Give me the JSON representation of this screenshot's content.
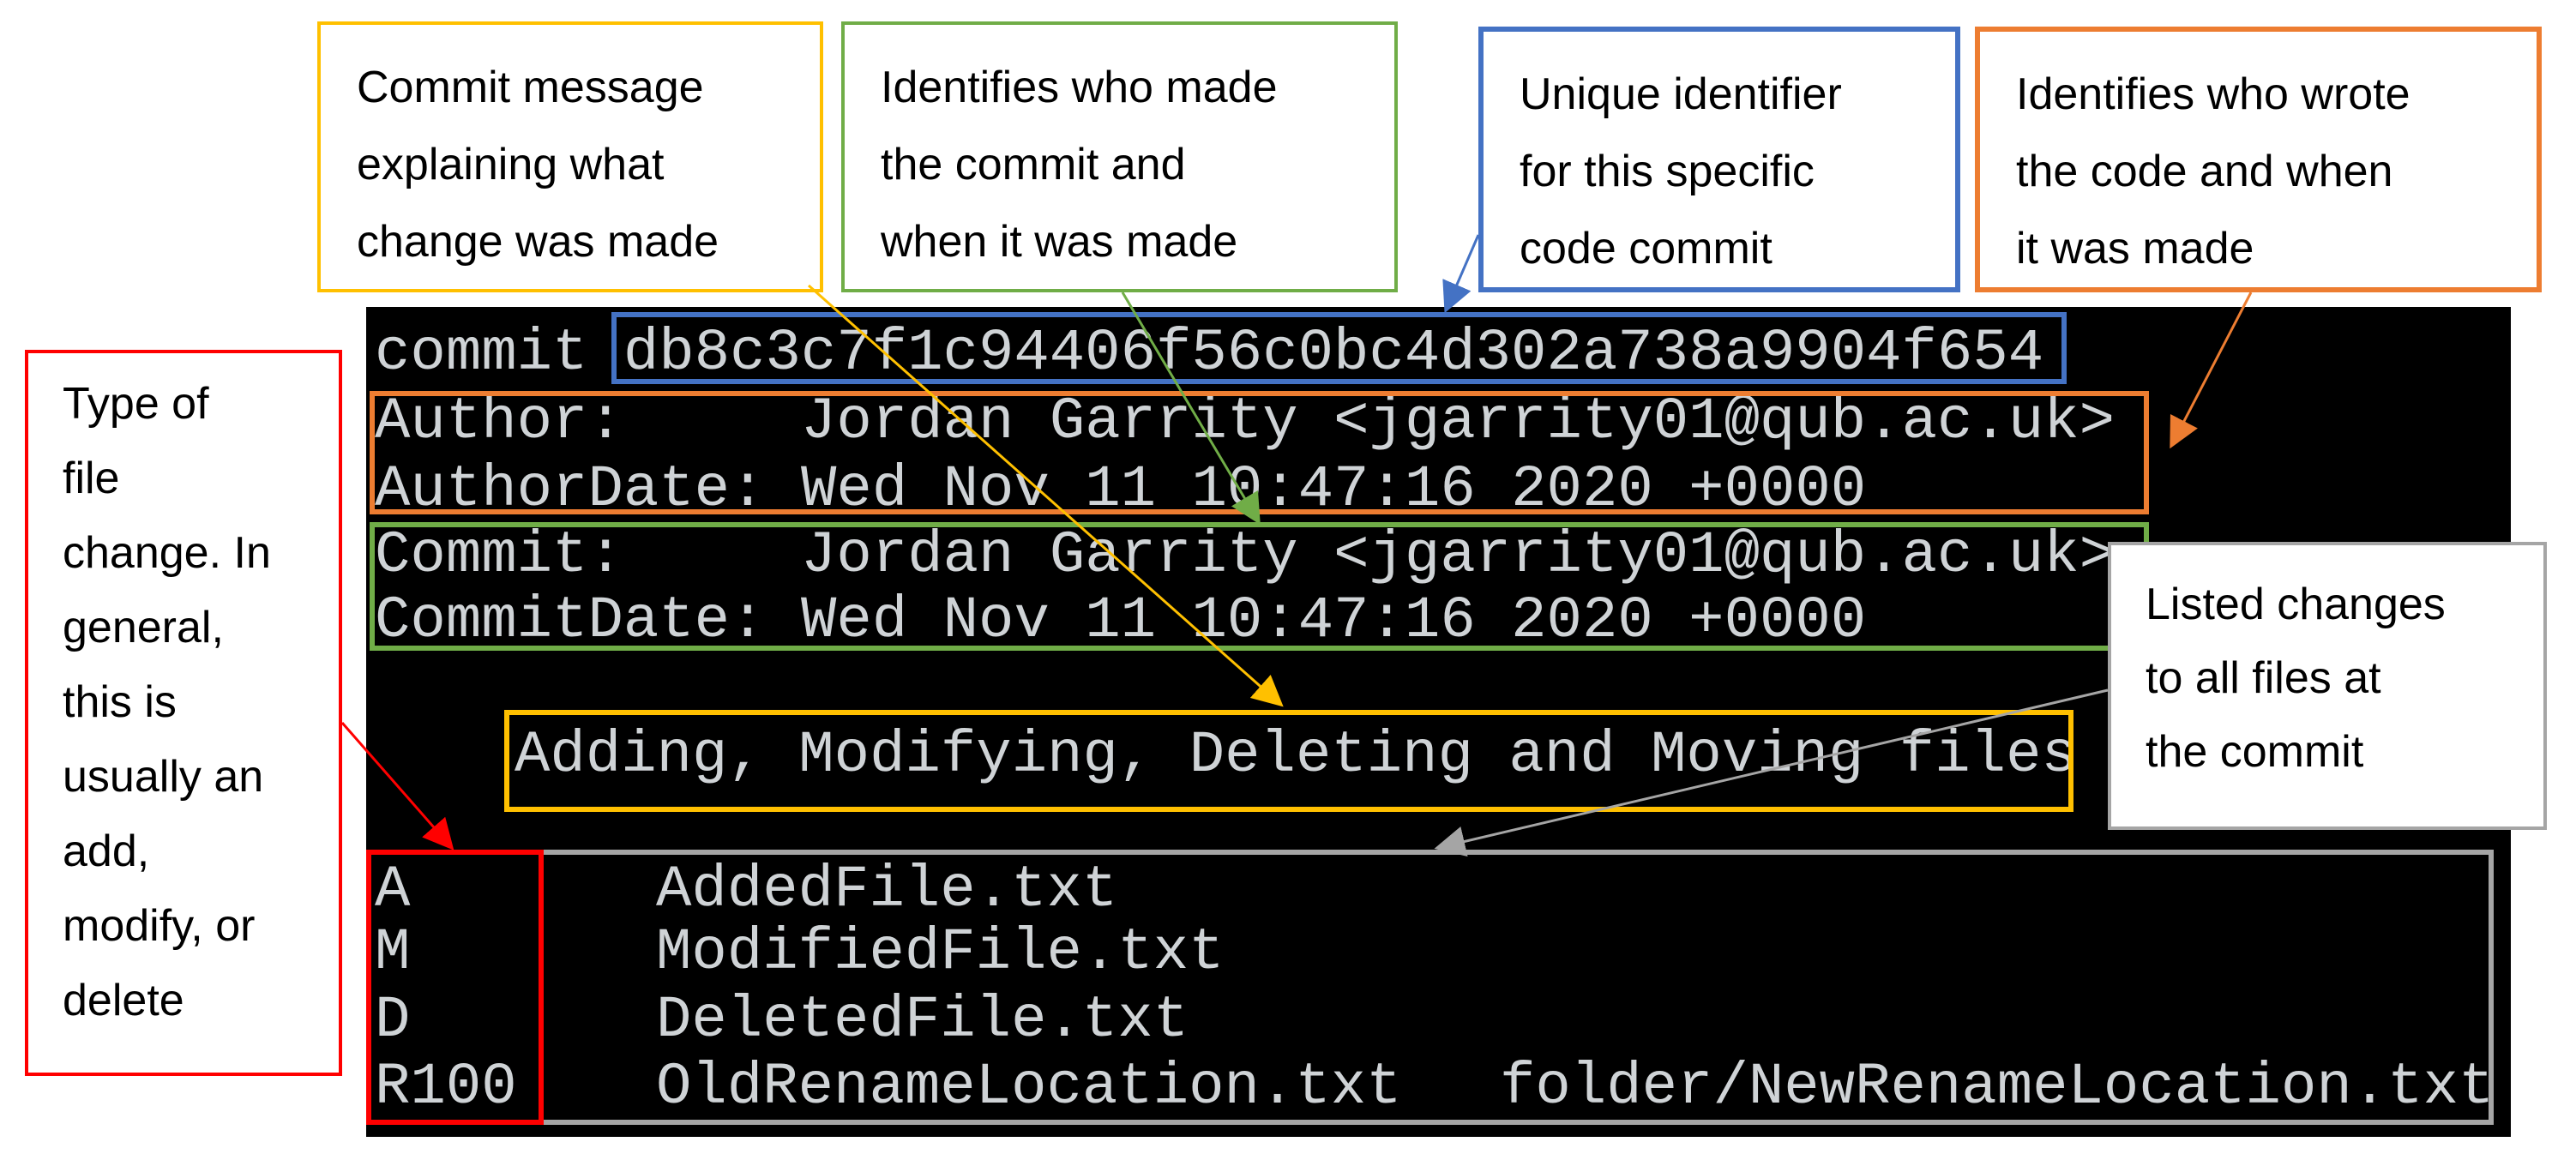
{
  "callouts": {
    "commit_message": [
      "Commit message",
      "explaining what",
      "change was made"
    ],
    "committer": [
      "Identifies who made",
      "the commit and",
      "when it was made"
    ],
    "identifier": [
      "Unique identifier",
      "for this specific",
      "code commit"
    ],
    "author": [
      "Identifies who wrote",
      "the code and when",
      "it was made"
    ],
    "change_type": [
      "Type of",
      "file",
      "change. In",
      "general,",
      "this is",
      "usually an",
      "add,",
      "modify, or",
      "delete"
    ],
    "file_list": [
      "Listed changes",
      "to all files at",
      "the commit"
    ]
  },
  "terminal": {
    "commit_label": "commit",
    "commit_hash": "db8c3c7f1c94406f56c0bc4d302a738a9904f654",
    "author_label": "Author:",
    "author_value": "Jordan Garrity <jgarrity01@qub.ac.uk>",
    "author_date_label": "AuthorDate:",
    "author_date_value": "Wed Nov 11 10:47:16 2020 +0000",
    "committer_label": "Commit:",
    "committer_value": "Jordan Garrity <jgarrity01@qub.ac.uk>",
    "commit_date_label": "CommitDate:",
    "commit_date_value": "Wed Nov 11 10:47:16 2020 +0000",
    "message": "Adding, Modifying, Deleting and Moving files",
    "files": [
      {
        "status": "A",
        "path": "AddedFile.txt",
        "new_path": ""
      },
      {
        "status": "M",
        "path": "ModifiedFile.txt",
        "new_path": ""
      },
      {
        "status": "D",
        "path": "DeletedFile.txt",
        "new_path": ""
      },
      {
        "status": "R100",
        "path": "OldRenameLocation.txt",
        "new_path": "folder/NewRenameLocation.txt"
      }
    ]
  },
  "colors": {
    "yellow": "#FFC000",
    "green": "#70AD47",
    "blue": "#4472C4",
    "orange": "#ED7D31",
    "red": "#FF0000",
    "gray": "#A5A5A5"
  }
}
